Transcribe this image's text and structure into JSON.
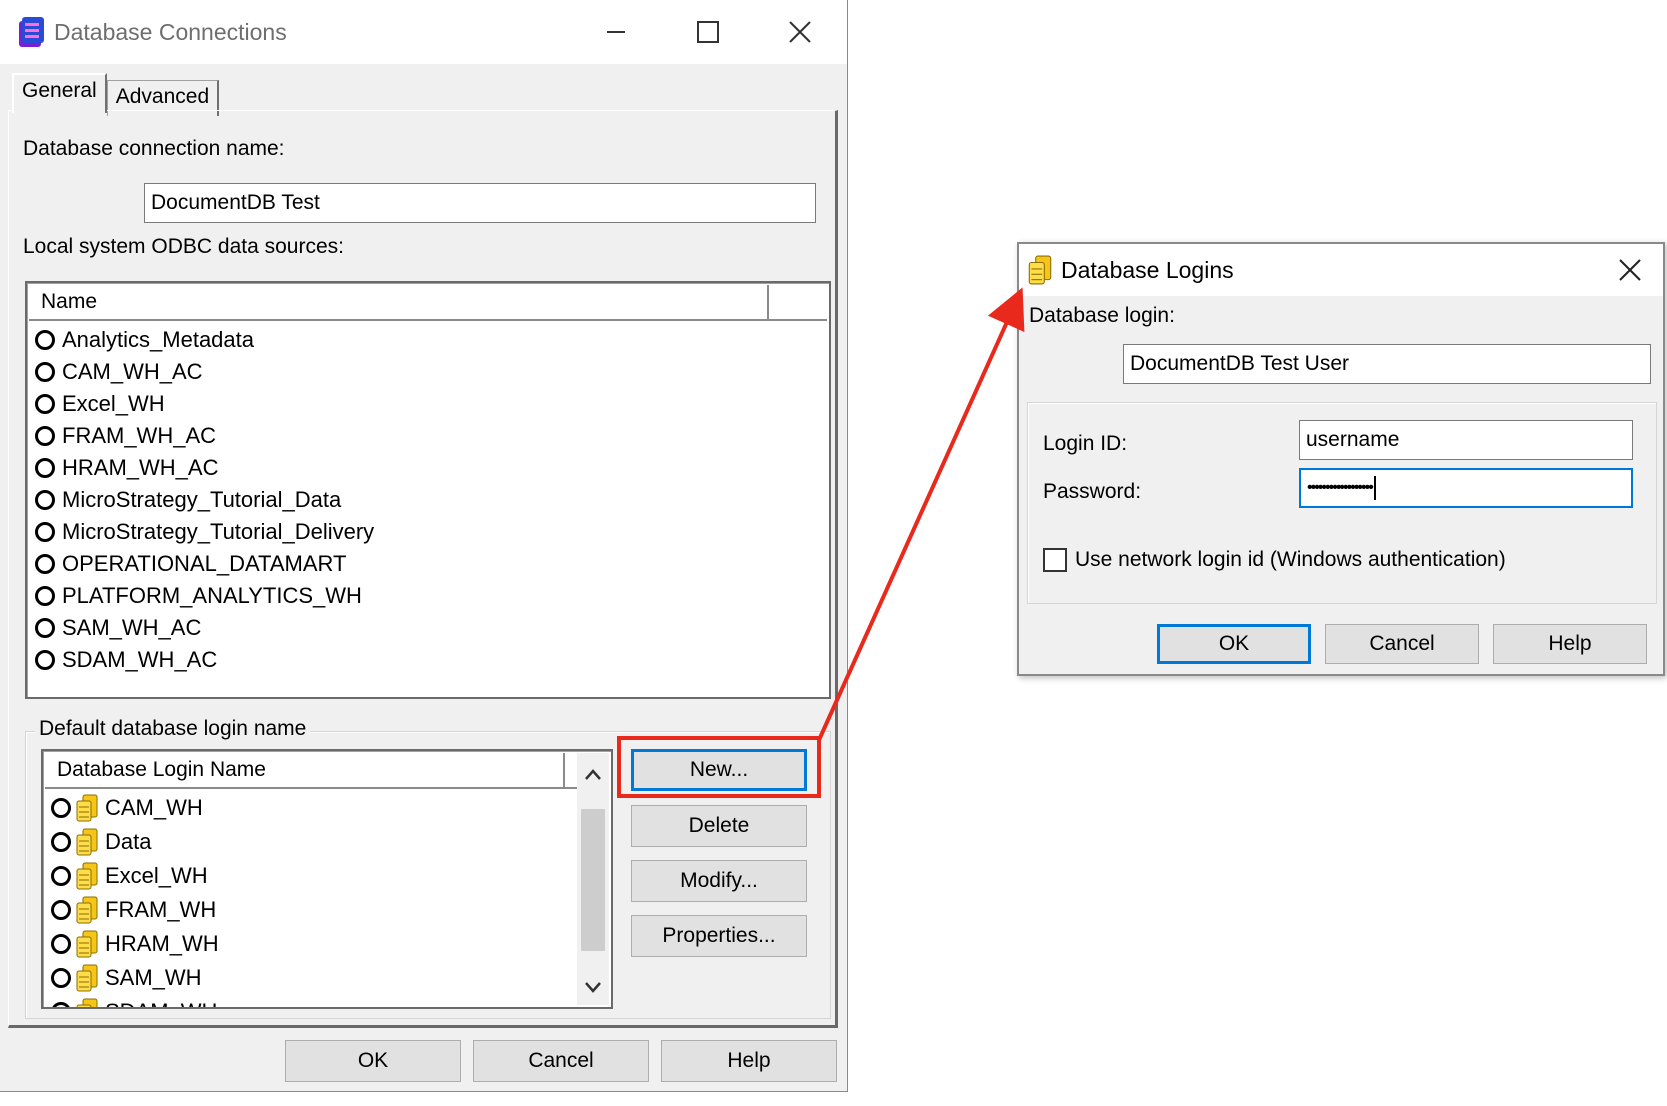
{
  "left_window": {
    "title": "Database Connections",
    "tabs": [
      "General",
      "Advanced"
    ],
    "connection_name_label": "Database connection name:",
    "connection_name_value": "DocumentDB Test",
    "odbc_label": "Local system ODBC data sources:",
    "odbc_header": "Name",
    "odbc_sources": [
      "Analytics_Metadata",
      "CAM_WH_AC",
      "Excel_WH",
      "FRAM_WH_AC",
      "HRAM_WH_AC",
      "MicroStrategy_Tutorial_Data",
      "MicroStrategy_Tutorial_Delivery",
      "OPERATIONAL_DATAMART",
      "PLATFORM_ANALYTICS_WH",
      "SAM_WH_AC",
      "SDAM_WH_AC"
    ],
    "login_group_title": "Default database login name",
    "login_header": "Database Login Name",
    "logins": [
      "CAM_WH",
      "Data",
      "Excel_WH",
      "FRAM_WH",
      "HRAM_WH",
      "SAM_WH",
      "SDAM_WH"
    ],
    "side_buttons": {
      "new": "New...",
      "delete": "Delete",
      "modify": "Modify...",
      "properties": "Properties..."
    },
    "footer_buttons": {
      "ok": "OK",
      "cancel": "Cancel",
      "help": "Help"
    }
  },
  "right_window": {
    "title": "Database Logins",
    "login_label": "Database login:",
    "login_value": "DocumentDB Test User",
    "login_id_label": "Login ID:",
    "login_id_value": "username",
    "password_label": "Password:",
    "password_value": "••••••••••••••••••",
    "network_login_label": "Use network login id (Windows authentication)",
    "buttons": {
      "ok": "OK",
      "cancel": "Cancel",
      "help": "Help"
    }
  },
  "colors": {
    "highlight_red": "#e8291c",
    "focus_blue": "#0078d7"
  }
}
